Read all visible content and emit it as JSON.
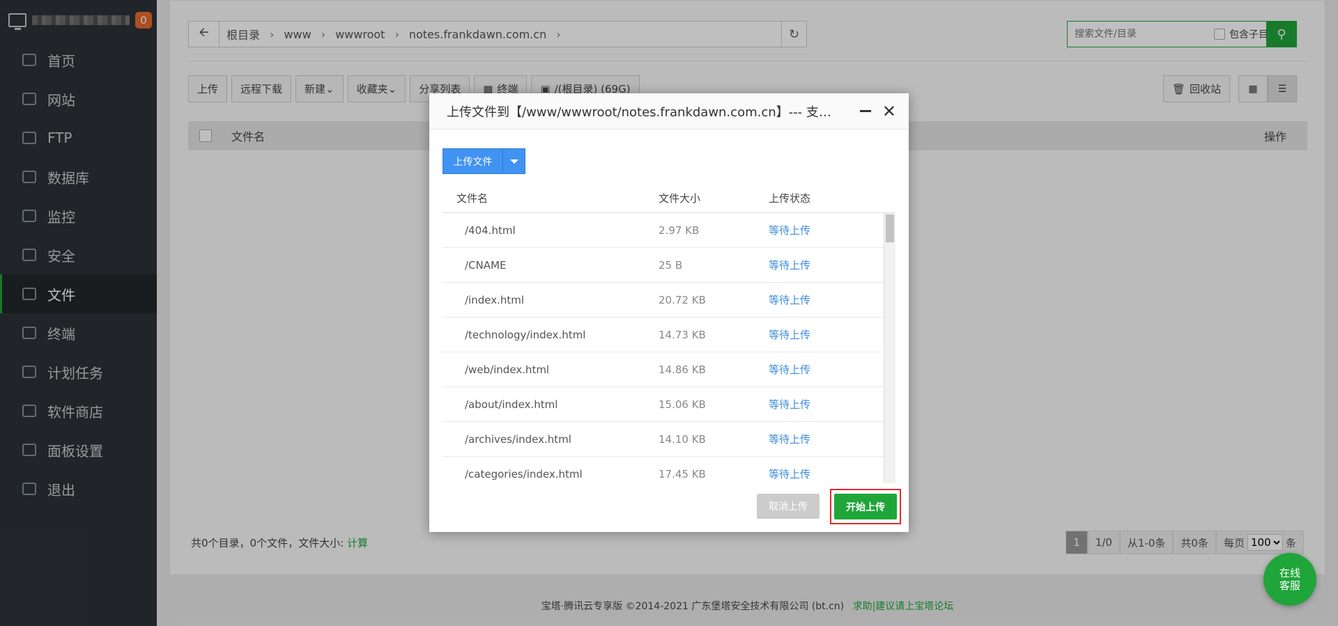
{
  "sidebar": {
    "badge": "0",
    "items": [
      {
        "label": "首页",
        "icon": "home-icon"
      },
      {
        "label": "网站",
        "icon": "globe-icon"
      },
      {
        "label": "FTP",
        "icon": "ftp-icon"
      },
      {
        "label": "数据库",
        "icon": "database-icon"
      },
      {
        "label": "监控",
        "icon": "monitor-icon"
      },
      {
        "label": "安全",
        "icon": "shield-icon"
      },
      {
        "label": "文件",
        "icon": "folder-icon"
      },
      {
        "label": "终端",
        "icon": "terminal-icon"
      },
      {
        "label": "计划任务",
        "icon": "calendar-icon"
      },
      {
        "label": "软件商店",
        "icon": "apps-icon"
      },
      {
        "label": "面板设置",
        "icon": "gear-icon"
      },
      {
        "label": "退出",
        "icon": "logout-icon"
      }
    ],
    "active_index": 6
  },
  "path": {
    "crumbs": [
      "根目录",
      "www",
      "wwwroot",
      "notes.frankdawn.com.cn"
    ]
  },
  "search": {
    "placeholder": "搜索文件/目录",
    "include_subdir": "包含子目录"
  },
  "toolbar": {
    "upload": "上传",
    "remote_download": "远程下载",
    "new": "新建",
    "favorites": "收藏夹",
    "share_list": "分享列表",
    "terminal": "终端",
    "disk": "/(根目录) (69G)",
    "recycle": "回收站"
  },
  "table": {
    "col_name": "文件名",
    "col_ops": "操作"
  },
  "footer": {
    "summary": "共0个目录，0个文件，文件大小:",
    "calc": "计算",
    "pager": {
      "current": "1",
      "pages": "1/0",
      "range": "从1-0条",
      "total": "共0条",
      "per_page_label": "每页",
      "per_page": "100",
      "unit": "条"
    }
  },
  "copyright": {
    "text": "宝塔·腾讯云专享版 ©2014-2021 广东堡塔安全技术有限公司 (bt.cn)",
    "link": "求助|建议请上宝塔论坛"
  },
  "modal": {
    "title": "上传文件到【/www/wwwroot/notes.frankdawn.com.cn】--- 支持断点续传",
    "upload_button": "上传文件",
    "headers": {
      "name": "文件名",
      "size": "文件大小",
      "status": "上传状态"
    },
    "files": [
      {
        "name": "/404.html",
        "size": "2.97 KB",
        "status": "等待上传"
      },
      {
        "name": "/CNAME",
        "size": "25 B",
        "status": "等待上传"
      },
      {
        "name": "/index.html",
        "size": "20.72 KB",
        "status": "等待上传"
      },
      {
        "name": "/technology/index.html",
        "size": "14.73 KB",
        "status": "等待上传"
      },
      {
        "name": "/web/index.html",
        "size": "14.86 KB",
        "status": "等待上传"
      },
      {
        "name": "/about/index.html",
        "size": "15.06 KB",
        "status": "等待上传"
      },
      {
        "name": "/archives/index.html",
        "size": "14.10 KB",
        "status": "等待上传"
      },
      {
        "name": "/categories/index.html",
        "size": "17.45 KB",
        "status": "等待上传"
      }
    ],
    "cancel": "取消上传",
    "start": "开始上传"
  },
  "service": {
    "line1": "在线",
    "line2": "客服"
  }
}
